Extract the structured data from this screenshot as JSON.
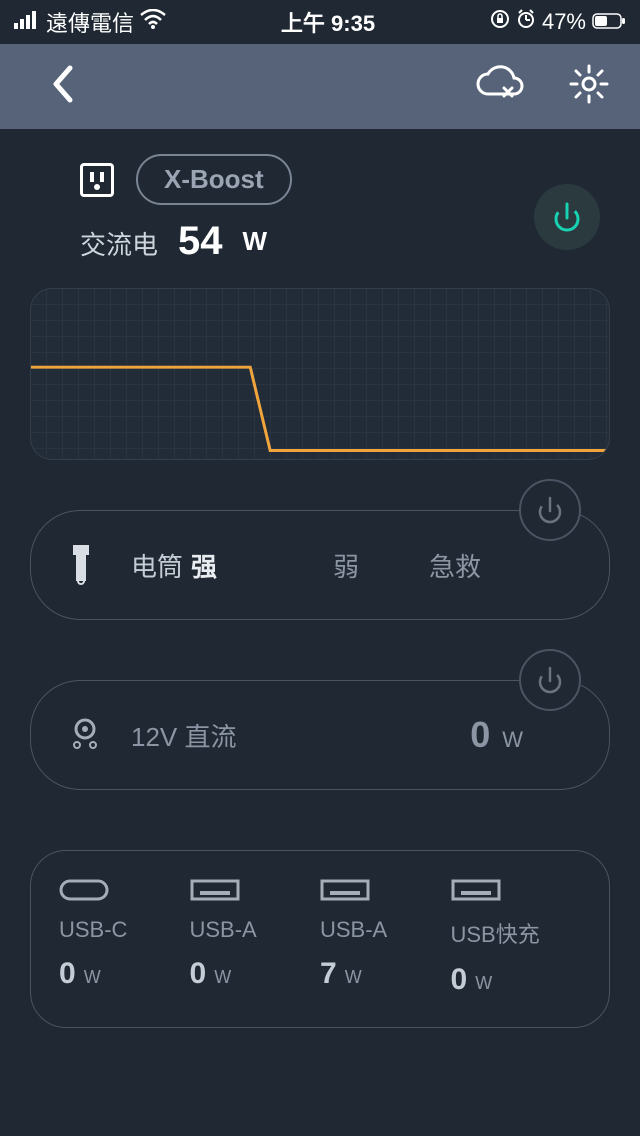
{
  "status": {
    "carrier": "遠傳電信",
    "time": "上午 9:35",
    "battery": "47%"
  },
  "ac": {
    "pill": "X-Boost",
    "label": "交流电",
    "value": "54",
    "unit": "W"
  },
  "chart_data": {
    "type": "line",
    "series": [
      {
        "name": "output_w",
        "values": [
          54,
          54,
          54,
          54,
          54,
          54,
          54,
          54,
          54,
          54,
          54,
          54,
          5,
          5,
          5,
          5,
          5,
          5,
          5,
          5,
          5,
          5,
          5,
          5,
          5,
          5,
          5,
          5,
          5,
          5
        ]
      }
    ],
    "ylim": [
      0,
      100
    ]
  },
  "flashlight": {
    "label": "电筒",
    "options": [
      "强",
      "弱",
      "急救"
    ]
  },
  "dc": {
    "label": "12V 直流",
    "value": "0",
    "unit": "W"
  },
  "usb": [
    {
      "name": "USB-C",
      "value": "0",
      "unit": "W",
      "shape": "c"
    },
    {
      "name": "USB-A",
      "value": "0",
      "unit": "W",
      "shape": "a"
    },
    {
      "name": "USB-A",
      "value": "7",
      "unit": "W",
      "shape": "a"
    },
    {
      "name": "USB快充",
      "value": "0",
      "unit": "W",
      "shape": "a"
    }
  ],
  "colors": {
    "accent": "#18d3b3",
    "line": "#f0a43c"
  }
}
